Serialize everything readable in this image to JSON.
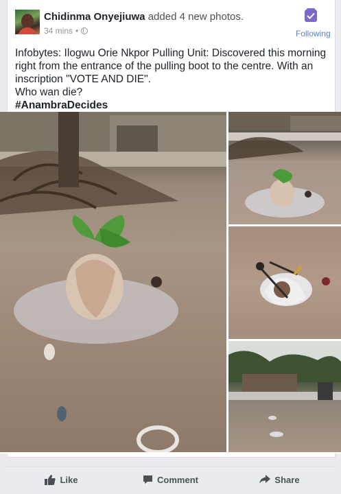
{
  "post": {
    "author": "Chidinma Onyejiuwa",
    "action_text": "added 4 new photos.",
    "time": "34 mins",
    "separator": "•",
    "follow_label": "Following",
    "text_lines": [
      "Infobytes: Ilogwu Orie Nkpor Pulling Unit: Discovered this morning right from the entrance of the pulling boot to the centre. With an inscription \"VOTE AND DIE\".",
      "Who wan die?"
    ],
    "hashtag": "#AnambraDecides",
    "photo_count": 4
  },
  "actions": {
    "like": "Like",
    "comment": "Comment",
    "share": "Share"
  },
  "icons": {
    "privacy": "globe-icon",
    "follow": "following-check-icon",
    "like": "thumbs-up-icon",
    "comment": "comment-bubble-icon",
    "share": "share-arrow-icon"
  },
  "colors": {
    "link": "#5b7ec0",
    "follow_accent": "#7b68c9",
    "text": "#1d2129",
    "muted": "#90949c"
  }
}
